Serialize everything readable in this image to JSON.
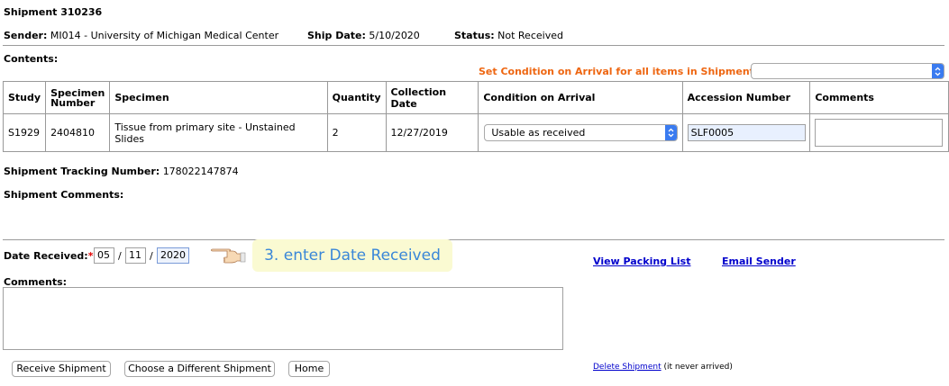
{
  "shipment": {
    "title": "Shipment 310236",
    "sender_label": "Sender:",
    "sender_value": "MI014 - University of Michigan Medical Center",
    "ship_date_label": "Ship Date:",
    "ship_date_value": "5/10/2020",
    "status_label": "Status:",
    "status_value": "Not Received",
    "contents_label": "Contents:",
    "set_condition_label": "Set Condition on Arrival for all items in Shipment:",
    "set_condition_value": ""
  },
  "table": {
    "headers": [
      "Study",
      "Specimen Number",
      "Specimen",
      "Quantity",
      "Collection Date",
      "Condition on Arrival",
      "Accession Number",
      "Comments"
    ],
    "rows": [
      {
        "study": "S1929",
        "specimen_number": "2404810",
        "specimen": "Tissue from primary site - Unstained Slides",
        "quantity": "2",
        "collection_date": "12/27/2019",
        "condition": "Usable as received",
        "accession": "SLF0005",
        "comments": ""
      }
    ]
  },
  "tracking": {
    "label": "Shipment Tracking Number:",
    "value": "178022147874",
    "comments_label": "Shipment Comments:"
  },
  "received": {
    "label": "Date Received:",
    "required_mark": "*",
    "month": "05",
    "day": "11",
    "year": "2020",
    "sep": "/"
  },
  "annotation": {
    "text": "3. enter Date Received",
    "pointer": "pointing-hand-icon"
  },
  "links": {
    "packing_list": "View Packing List",
    "email_sender": "Email Sender",
    "delete_shipment": "Delete Shipment",
    "delete_note": "(it never arrived)"
  },
  "comments": {
    "label": "Comments:",
    "value": ""
  },
  "buttons": {
    "receive": "Receive Shipment",
    "choose_different": "Choose a Different Shipment",
    "home": "Home"
  },
  "colors": {
    "orange_label": "#ee6611",
    "link": "#0000cc",
    "callout_bg": "#fafad2",
    "callout_text": "#3a87d8",
    "select_arrow": "#3a7bf0",
    "accession_bg": "#e8f0fe"
  }
}
